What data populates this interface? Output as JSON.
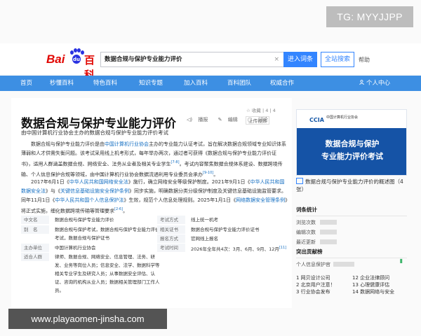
{
  "watermark_top": "TG: MYYJJPP",
  "watermark_bottom": "www.playaomen-jinsha.com",
  "header": {
    "logo_bai": "Bai",
    "logo_du": "du",
    "logo_baike": "百科",
    "search_value": "数据合规与保护专业能力评价",
    "clear_icon": "×",
    "enter_button": "进入词条",
    "all_search_button": "全站搜索",
    "help_link": "帮助"
  },
  "nav": {
    "items": [
      "首页",
      "秒懂百科",
      "特色百科",
      "知识专题",
      "加入百科",
      "百科团队",
      "权威合作"
    ],
    "user_label": "个人中心",
    "user_icon": "person-icon"
  },
  "article": {
    "title": "数据合规与保护专业能力评价",
    "tools": [
      "播报",
      "编辑",
      "讨论",
      "上传视频"
    ],
    "collect": "☆ 收藏 | 4 | 4",
    "subtitle": "由中国计算机行业协会主办的数据合规与保护专业能力评价考试",
    "p1a": "数据合规与保护专业能力评价是由",
    "p1link1": "中国计算机行业协会",
    "p1b": "主办的专业能力认证考试，旨在解决数据合规领域专业知识体系薄弱和人才供需失衡问题。该考试采用线上机考形式，每年举办两次，通过者可获得《数据合规与保护专业能力评价证书》，适用人群涵盖数据合规、网络安全、法务从业者及相关专业学生",
    "p1sup1": "[7-8]",
    "p1c": "。考试内容聚焦数据合规体系建设、数据跨境传输、个人信息保护合规等领域，由中国计算机行业协会数据流通利用专业委员会承办",
    "p1sup2": "[9-10]",
    "p1d": "。",
    "p2a": "2017年6月1日《",
    "p2link1": "中华人民共和国网络安全法",
    "p2b": "》施行，确立网络安全等级保护制度。2021年9月1日《",
    "p2link2": "中华人民共和国数据安全法",
    "p2c": "》与《",
    "p2link3": "关键信息基础设施安全保护条例",
    "p2d": "》同步实施，明确数据分类分级保护制度及关键信息基础设施监管要求。同年11月1日《",
    "p2link4": "中华人民共和国个人信息保护法",
    "p2e": "》生效，规范个人信息处理规则。2025年1月1日《",
    "p2link5": "网络数据安全管理条例",
    "p2f": "》将正式实施，细化数据跨境传输等管理要求",
    "p2sup": "[2-6]",
    "p2g": "。"
  },
  "info": {
    "k_cn": "中文名",
    "v_cn": "数据合规与保护专业能力评价",
    "k_alias": "别　名",
    "v_alias1": "数据合规与保护考试，数据合规与保护专业能力评价",
    "v_alias2": "考试，数据合规与保护证书",
    "k_org": "主办单位",
    "v_org": "中国计算机行业协会",
    "k_people": "适合人群",
    "v_people1": "律师、数据合规、网络安全、信息管理、法务、研",
    "v_people2": "发、业务等岗位人员；信息安全、法学、数据科学等",
    "v_people3": "相关专业学生及研究人员；从事数据安全评估、认",
    "v_people4": "证、咨询的机构从业人员；数据相关管理部门工作人",
    "v_people5": "员。",
    "k_form": "考试方式",
    "v_form": "线上统一机考",
    "k_cert": "相关证书",
    "v_cert": "数据合规与保护专业能力评价证书",
    "k_signup": "报名方式",
    "v_signup": "官网线上报名",
    "k_time": "考试时间",
    "v_time": "2026年全年共4次：3月、6月、9月、12月",
    "v_time_sup": "[11]"
  },
  "sidebar": {
    "poster_ccia": "CCIA",
    "poster_org": "中国计算机行业协会",
    "poster_line1": "数据合规与保护",
    "poster_line2": "专业能力评价考试",
    "album_title": "数据合规与保护专业能力评价的概述图（4张）",
    "stats_title": "词条统计",
    "stats_views": "浏览次数",
    "stats_edits": "编辑次数",
    "stats_updated": "最近更新",
    "contrib_title": "突出贡献榜",
    "contrib_row": "个人信息保护官",
    "hot_left": [
      "1 网贝设计公司",
      "2 北京用户注意！",
      "3 行业协会发布"
    ],
    "hot_right": [
      "12 企业法律顾问",
      "13 心理健康评估",
      "14 数据网络与安全"
    ]
  }
}
